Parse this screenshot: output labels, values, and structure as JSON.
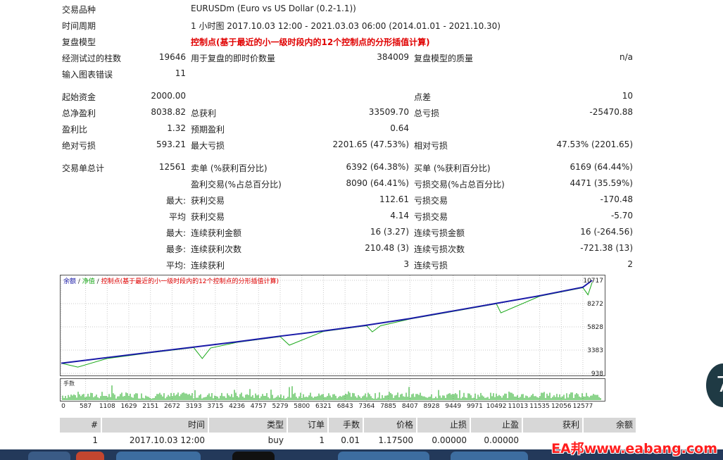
{
  "report": {
    "symbol": {
      "label": "交易品种",
      "value": "EURUSDm (Euro vs US Dollar (0.2-1.1))"
    },
    "period": {
      "label": "时间周期",
      "value": "1 小时图 2017.10.03 12:00 - 2021.03.03 06:00 (2014.01.01 - 2021.10.30)"
    },
    "model": {
      "label": "复盘模型",
      "value": "控制点(基于最近的小一级时段内的12个控制点的分形插值计算)"
    },
    "bars": {
      "label": "经测试过的柱数",
      "value": "19646",
      "ticks_label": "用于复盘的即时价数量",
      "ticks_value": "384009",
      "quality_label": "复盘模型的质量",
      "quality_value": "n/a"
    },
    "errors": {
      "label": "输入图表错误",
      "value": "11"
    },
    "deposit": {
      "label": "起始资金",
      "value": "2000.00",
      "spread_label": "点差",
      "spread_value": "10"
    },
    "net": {
      "label": "总净盈利",
      "value": "8038.82",
      "gross_profit_label": "总获利",
      "gross_profit_value": "33509.70",
      "gross_loss_label": "总亏损",
      "gross_loss_value": "-25470.88"
    },
    "pf": {
      "label": "盈利比",
      "value": "1.32",
      "expected_label": "预期盈利",
      "expected_value": "0.64"
    },
    "dd": {
      "label": "绝对亏损",
      "value": "593.21",
      "max_label": "最大亏损",
      "max_value": "2201.65 (47.53%)",
      "rel_label": "相对亏损",
      "rel_value": "47.53% (2201.65)"
    },
    "trades": {
      "label": "交易单总计",
      "value": "12561",
      "short_label": "卖单 (%获利百分比)",
      "short_value": "6392 (64.38%)",
      "long_label": "买单 (%获利百分比)",
      "long_value": "6169 (64.44%)"
    },
    "winloss": {
      "profit_label": "盈利交易(%占总百分比)",
      "profit_value": "8090 (64.41%)",
      "loss_label": "亏损交易(%占总百分比)",
      "loss_value": "4471 (35.59%)"
    },
    "largest": {
      "prefix": "最大:",
      "profit_label": "获利交易",
      "profit_value": "112.61",
      "loss_label": "亏损交易",
      "loss_value": "-170.48"
    },
    "average": {
      "prefix": "平均",
      "profit_label": "获利交易",
      "profit_value": "4.14",
      "loss_label": "亏损交易",
      "loss_value": "-5.70"
    },
    "max_cons_amt": {
      "prefix": "最大:",
      "win_label": "连续获利金额",
      "win_value": "16 (3.27)",
      "loss_label": "连续亏损金额",
      "loss_value": "16 (-264.56)"
    },
    "max_cons_cnt": {
      "prefix": "最多:",
      "win_label": "连续获利次数",
      "win_value": "210.48 (3)",
      "loss_label": "连续亏损次数",
      "loss_value": "-721.38 (13)"
    },
    "avg_cons": {
      "prefix": "平均:",
      "win_label": "连续获利",
      "win_value": "3",
      "loss_label": "连续亏损",
      "loss_value": "2"
    }
  },
  "chart_data": {
    "type": "line",
    "legend": [
      "余额",
      "/",
      "净值",
      "/",
      "控制点(基于最近的小一级时段内的12个控制点的分形插值计算)"
    ],
    "legend_colors": [
      "#1a1aa8",
      "#333333",
      "#1aa81a",
      "#333333",
      "#e00000"
    ],
    "balance_color": "#1a1aa8",
    "equity_color": "#1aa81a",
    "y_ticks": [
      "10717",
      "8272",
      "5828",
      "3383",
      "938"
    ],
    "ylim": [
      938,
      10717
    ],
    "x_ticks": [
      "0",
      "587",
      "1108",
      "1629",
      "2151",
      "2672",
      "3193",
      "3715",
      "4236",
      "4757",
      "5279",
      "5800",
      "6321",
      "6843",
      "7364",
      "7885",
      "8407",
      "8928",
      "9449",
      "9971",
      "10492",
      "11013",
      "11535",
      "12056",
      "12577"
    ],
    "xlim": [
      0,
      12900
    ],
    "series": [
      {
        "name": "余额",
        "x": [
          0,
          1108,
          2151,
          3193,
          4236,
          5279,
          6321,
          7364,
          8407,
          9449,
          10492,
          11535,
          12577,
          12800
        ],
        "y": [
          2000,
          2600,
          3150,
          3700,
          4250,
          4850,
          5400,
          6000,
          6700,
          7500,
          8300,
          9100,
          10000,
          10717
        ]
      },
      {
        "name": "净值",
        "x": [
          0,
          400,
          1108,
          2151,
          3193,
          3400,
          3600,
          4236,
          5279,
          5500,
          6321,
          7364,
          7500,
          7700,
          8407,
          9449,
          10492,
          10600,
          11535,
          12577,
          12700,
          12800
        ],
        "y": [
          2000,
          1600,
          2500,
          3100,
          3650,
          2500,
          3600,
          4200,
          4800,
          3900,
          5350,
          5950,
          5300,
          5950,
          6650,
          7450,
          8250,
          7300,
          9050,
          9950,
          9200,
          10500
        ]
      }
    ],
    "volume_label": "手数",
    "volume_color": "#1aa81a"
  },
  "trade_table": {
    "headers": [
      "#",
      "时间",
      "类型",
      "订单",
      "手数",
      "价格",
      "止损",
      "止盈",
      "获利",
      "余额"
    ],
    "rows": [
      [
        "1",
        "2017.10.03 12:00",
        "buy",
        "1",
        "0.01",
        "1.17500",
        "0.00000",
        "0.00000",
        "",
        ""
      ]
    ]
  },
  "watermark": "EA邦www.eabang.com",
  "badge": "7"
}
